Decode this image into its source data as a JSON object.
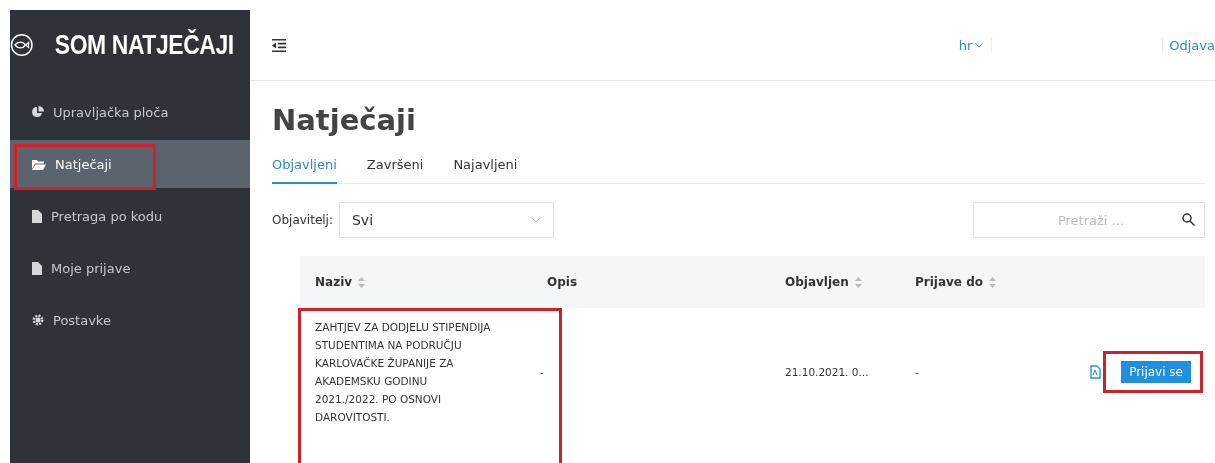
{
  "logo": {
    "text": "SOM NATJEČAJI"
  },
  "sidebar": {
    "items": [
      {
        "label": "Upravljačka ploča",
        "kind": "pie",
        "selected": false,
        "highlighted": false
      },
      {
        "label": "Natječaji",
        "kind": "folder",
        "selected": true,
        "highlighted": true
      },
      {
        "label": "Pretraga po kodu",
        "kind": "file-question",
        "selected": false,
        "highlighted": false
      },
      {
        "label": "Moje prijave",
        "kind": "file",
        "selected": false,
        "highlighted": false
      },
      {
        "label": "Postavke",
        "kind": "gear",
        "selected": false,
        "highlighted": false
      }
    ]
  },
  "topbar": {
    "language": "hr",
    "logout": "Odjava"
  },
  "page": {
    "title": "Natječaji"
  },
  "tabs": [
    {
      "label": "Objavljeni",
      "selected": true
    },
    {
      "label": "Završeni",
      "selected": false
    },
    {
      "label": "Najavljeni",
      "selected": false
    }
  ],
  "filter": {
    "label": "Objavitelj:",
    "value": "Svi"
  },
  "search": {
    "placeholder": "Pretraži ..."
  },
  "table": {
    "columns": [
      {
        "label": "Naziv",
        "sortable": true
      },
      {
        "label": "Opis",
        "sortable": false
      },
      {
        "label": "Objavljen",
        "sortable": true
      },
      {
        "label": "Prijave do",
        "sortable": true
      }
    ],
    "rows": [
      {
        "naziv": "ZAHTJEV ZA DODJELU STIPENDIJA STUDENTIMA NA PODRUČJU KARLOVAČKE ŽUPANIJE ZA AKADEMSKU GODINU 2021./2022. PO OSNOVI DAROVITOSTI.",
        "opis": "-",
        "objavljen": "21.10.2021. 0...",
        "prijave_do": "-",
        "action": "Prijavi se",
        "naziv_highlighted": true,
        "action_highlighted": true
      }
    ]
  }
}
